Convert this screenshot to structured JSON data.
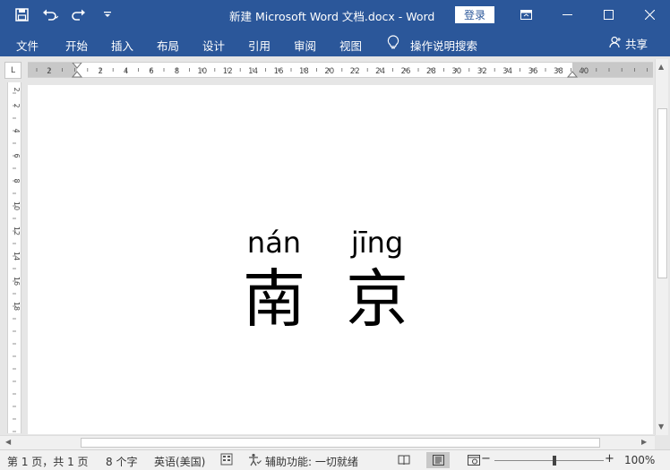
{
  "title_bar": {
    "document_title": "新建 Microsoft Word 文档.docx  -  Word",
    "login_label": "登录",
    "icons": [
      "save-icon",
      "undo-icon",
      "redo-icon",
      "customize-qat-icon",
      "ribbon-display-icon",
      "minimize-icon",
      "maximize-icon",
      "close-icon"
    ]
  },
  "menu": {
    "items": [
      "文件",
      "开始",
      "插入",
      "布局",
      "设计",
      "引用",
      "审阅",
      "视图"
    ],
    "tell_me": "操作说明搜索",
    "share": "共享"
  },
  "ruler": {
    "corner": "L",
    "h_ticks": [
      "2",
      "2",
      "4",
      "6",
      "8",
      "10",
      "12",
      "14",
      "16",
      "18",
      "20",
      "22",
      "24",
      "26",
      "28",
      "30",
      "32",
      "34",
      "36",
      "38",
      "40"
    ],
    "v_ticks": [
      "2",
      "2",
      "4",
      "6",
      "8",
      "10",
      "12",
      "14",
      "16",
      "18"
    ]
  },
  "document": {
    "words": [
      {
        "pinyin": "nán",
        "hanzi": "南"
      },
      {
        "pinyin": "jīng",
        "hanzi": "京"
      }
    ]
  },
  "status": {
    "page": "第 1 页，共 1 页",
    "words": "8 个字",
    "language": "英语(美国)",
    "accessibility": "辅助功能: 一切就绪",
    "zoom": "100%",
    "zoom_minus": "−",
    "zoom_plus": "+"
  }
}
